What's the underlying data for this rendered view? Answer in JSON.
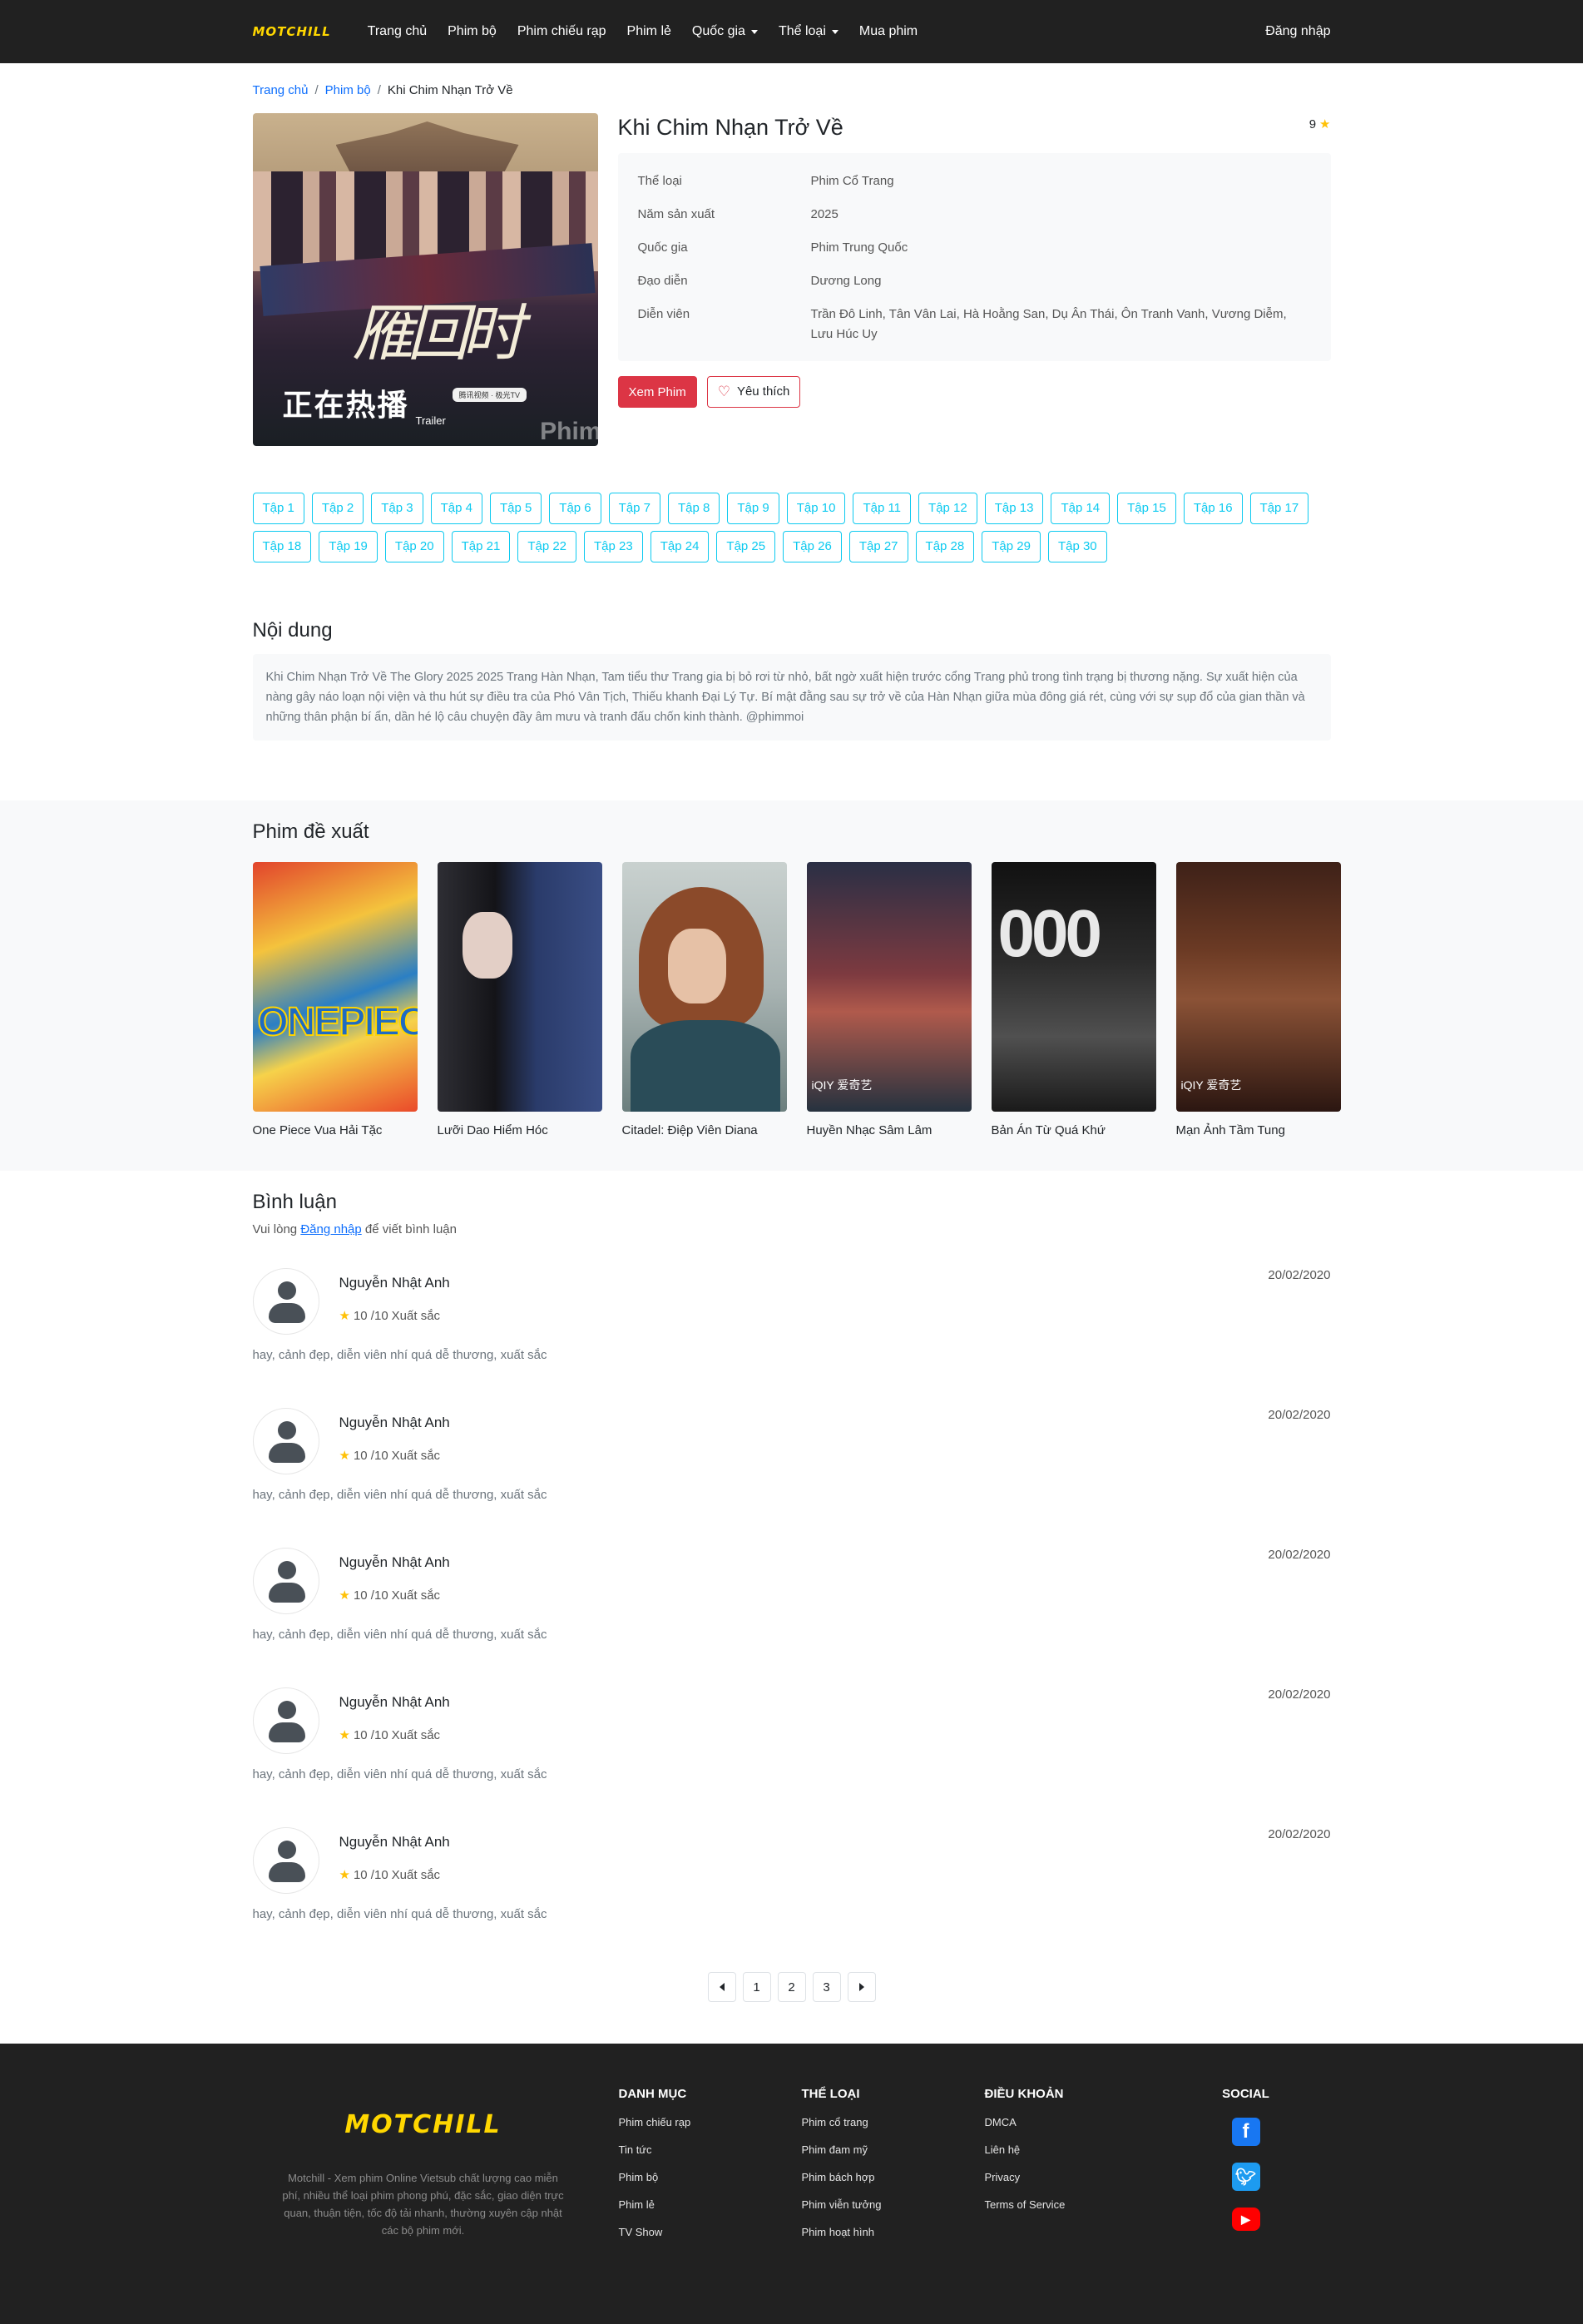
{
  "nav": {
    "logo": "MOTCHILL",
    "items": [
      "Trang chủ",
      "Phim bộ",
      "Phim chiếu rạp",
      "Phim lẻ",
      "Quốc gia",
      "Thể loại",
      "Mua phim"
    ],
    "dropdowns": [
      false,
      false,
      false,
      false,
      true,
      true,
      false
    ],
    "login": "Đăng nhập"
  },
  "breadcrumb": {
    "home": "Trang chủ",
    "section": "Phim bộ",
    "current": "Khi Chim Nhạn Trở Về",
    "sep": "/"
  },
  "movie": {
    "title": "Khi Chim Nhạn Trở Về",
    "rating": "9",
    "poster": {
      "calligraphy": "雁回时",
      "banner": "正在热播",
      "trailer": "Trailer",
      "tag": "腾讯视频 · 极光TV",
      "watermark": "Phim"
    },
    "details": [
      {
        "label": "Thể loại",
        "value": "Phim Cổ Trang"
      },
      {
        "label": "Năm sản xuất",
        "value": "2025"
      },
      {
        "label": "Quốc gia",
        "value": "Phim Trung Quốc"
      },
      {
        "label": "Đạo diễn",
        "value": "Dương Long"
      },
      {
        "label": "Diễn viên",
        "value": "Trần Đô Linh, Tân Vân Lai, Hà Hoằng San, Dụ Ân Thái, Ôn Tranh Vanh, Vương Diễm, Lưu Húc Uy"
      }
    ],
    "watch_button": "Xem Phim",
    "like_button": "Yêu thích"
  },
  "episodes": [
    "Tập 1",
    "Tập 2",
    "Tập 3",
    "Tập 4",
    "Tập 5",
    "Tập 6",
    "Tập 7",
    "Tập 8",
    "Tập 9",
    "Tập 10",
    "Tập 11",
    "Tập 12",
    "Tập 13",
    "Tập 14",
    "Tập 15",
    "Tập 16",
    "Tập 17",
    "Tập 18",
    "Tập 19",
    "Tập 20",
    "Tập 21",
    "Tập 22",
    "Tập 23",
    "Tập 24",
    "Tập 25",
    "Tập 26",
    "Tập 27",
    "Tập 28",
    "Tập 29",
    "Tập 30"
  ],
  "content": {
    "title": "Nội dung",
    "text": "Khi Chim Nhạn Trở Về The Glory 2025 2025 Trang Hàn Nhạn, Tam tiểu thư Trang gia bị bỏ rơi từ nhỏ, bất ngờ xuất hiện trước cổng Trang phủ trong tình trạng bị thương nặng. Sự xuất hiện của nàng gây náo loạn nội viện và thu hút sự điều tra của Phó Vân Tịch, Thiếu khanh Đại Lý Tự. Bí mật đằng sau sự trở về của Hàn Nhạn giữa mùa đông giá rét, cùng với sự sụp đổ của gian thần và những thân phận bí ẩn, dần hé lộ câu chuyện đầy âm mưu và tranh đấu chốn kinh thành. @phimmoi"
  },
  "suggest": {
    "title": "Phim đề xuất",
    "items": [
      {
        "title": "One Piece Vua Hải Tặc",
        "art": "ONEPIECE"
      },
      {
        "title": "Lưỡi Dao Hiểm Hóc",
        "art": ""
      },
      {
        "title": "Citadel: Điệp Viên Diana",
        "art": ""
      },
      {
        "title": "Huyền Nhạc Sâm Lâm",
        "art": "iQIY 爱奇艺"
      },
      {
        "title": "Bản Án Từ Quá Khứ",
        "art": "000"
      },
      {
        "title": "Mạn Ảnh Tầm Tung",
        "art": "iQIY 爱奇艺"
      }
    ]
  },
  "comments": {
    "title": "Bình luận",
    "login_prompt_before": "Vui lòng ",
    "login_link": "Đăng nhập",
    "login_prompt_after": " để viết bình luận",
    "items": [
      {
        "name": "Nguyễn Nhật Anh",
        "score": "10 /10",
        "label": "Xuất sắc",
        "date": "20/02/2020",
        "text": "hay, cảnh đẹp, diễn viên nhí quá dễ thương, xuất sắc"
      },
      {
        "name": "Nguyễn Nhật Anh",
        "score": "10 /10",
        "label": "Xuất sắc",
        "date": "20/02/2020",
        "text": "hay, cảnh đẹp, diễn viên nhí quá dễ thương, xuất sắc"
      },
      {
        "name": "Nguyễn Nhật Anh",
        "score": "10 /10",
        "label": "Xuất sắc",
        "date": "20/02/2020",
        "text": "hay, cảnh đẹp, diễn viên nhí quá dễ thương, xuất sắc"
      },
      {
        "name": "Nguyễn Nhật Anh",
        "score": "10 /10",
        "label": "Xuất sắc",
        "date": "20/02/2020",
        "text": "hay, cảnh đẹp, diễn viên nhí quá dễ thương, xuất sắc"
      },
      {
        "name": "Nguyễn Nhật Anh",
        "score": "10 /10",
        "label": "Xuất sắc",
        "date": "20/02/2020",
        "text": "hay, cảnh đẹp, diễn viên nhí quá dễ thương, xuất sắc"
      }
    ]
  },
  "pagination": {
    "pages": [
      "1",
      "2",
      "3"
    ]
  },
  "footer": {
    "logo": "MOTCHILL",
    "description": "Motchill - Xem phim Online Vietsub chất lượng cao miễn phí, nhiều thể loại phim phong phú, đặc sắc, giao diện trực quan, thuận tiện, tốc độ tải nhanh, thường xuyên cập nhật các bộ phim mới.",
    "columns": [
      {
        "title": "DANH MỤC",
        "links": [
          "Phim chiếu rạp",
          "Tin tức",
          "Phim bộ",
          "Phim lẻ",
          "TV Show"
        ]
      },
      {
        "title": "THỂ LOẠI",
        "links": [
          "Phim cổ trang",
          "Phim đam mỹ",
          "Phim bách hợp",
          "Phim viễn tưởng",
          "Phim hoạt hình"
        ]
      },
      {
        "title": "ĐIỀU KHOẢN",
        "links": [
          "DMCA",
          "Liên hệ",
          "Privacy",
          "Terms of Service"
        ]
      }
    ],
    "social_title": "SOCIAL",
    "social": [
      {
        "icon": "facebook-icon",
        "color": "#1877f2"
      },
      {
        "icon": "twitter-icon",
        "color": "#1d9bf0"
      },
      {
        "icon": "youtube-icon",
        "color": "#ff0000"
      }
    ]
  },
  "colors": {
    "nav_bg": "#212121",
    "logo": "#ffd700",
    "link": "#0d6efd",
    "danger": "#dc3545",
    "episode": "#0dcaf0",
    "star": "#ffc107"
  }
}
